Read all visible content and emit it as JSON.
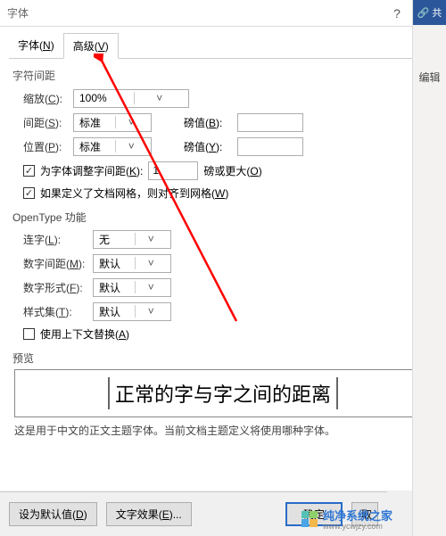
{
  "title": "字体",
  "help_icon": "?",
  "close_icon": "×",
  "tabs": {
    "font": {
      "label": "字体",
      "mnemonic": "N"
    },
    "advanced": {
      "label": "高级",
      "mnemonic": "V"
    }
  },
  "char_spacing": {
    "section": "字符间距",
    "scale": {
      "label": "缩放",
      "mnemonic": "C",
      "value": "100%"
    },
    "spacing": {
      "label": "间距",
      "mnemonic": "S",
      "value": "标准"
    },
    "spacing_by": {
      "label": "磅值",
      "mnemonic": "B",
      "value": ""
    },
    "position": {
      "label": "位置",
      "mnemonic": "P",
      "value": "标准"
    },
    "position_by": {
      "label": "磅值",
      "mnemonic": "Y",
      "value": ""
    },
    "kerning": {
      "label": "为字体调整字间距",
      "mnemonic": "K",
      "value": "1",
      "suffix": "磅或更大",
      "suffix_mn": "O"
    },
    "snap": {
      "label": "如果定义了文档网格，则对齐到网格",
      "mnemonic": "W"
    }
  },
  "opentype": {
    "section": "OpenType 功能",
    "ligature": {
      "label": "连字",
      "mnemonic": "L",
      "value": "无"
    },
    "num_spacing": {
      "label": "数字间距",
      "mnemonic": "M",
      "value": "默认"
    },
    "num_form": {
      "label": "数字形式",
      "mnemonic": "F",
      "value": "默认"
    },
    "stylistic": {
      "label": "样式集",
      "mnemonic": "T",
      "value": "默认"
    },
    "contextual": {
      "label": "使用上下文替换",
      "mnemonic": "A"
    }
  },
  "preview": {
    "section": "预览",
    "text": "正常的字与字之间的距离",
    "desc": "这是用于中文的正文主题字体。当前文档主题定义将使用哪种字体。"
  },
  "buttons": {
    "default": {
      "label": "设为默认值",
      "mnemonic": "D"
    },
    "effects": {
      "label": "文字效果",
      "mnemonic": "E"
    },
    "ok": "确定",
    "cancel": "取"
  },
  "right": {
    "share": "🔗 共",
    "edit": "编辑"
  },
  "watermark": {
    "text": "纯净系统之家",
    "sub": "www.ycwjzy.com"
  }
}
